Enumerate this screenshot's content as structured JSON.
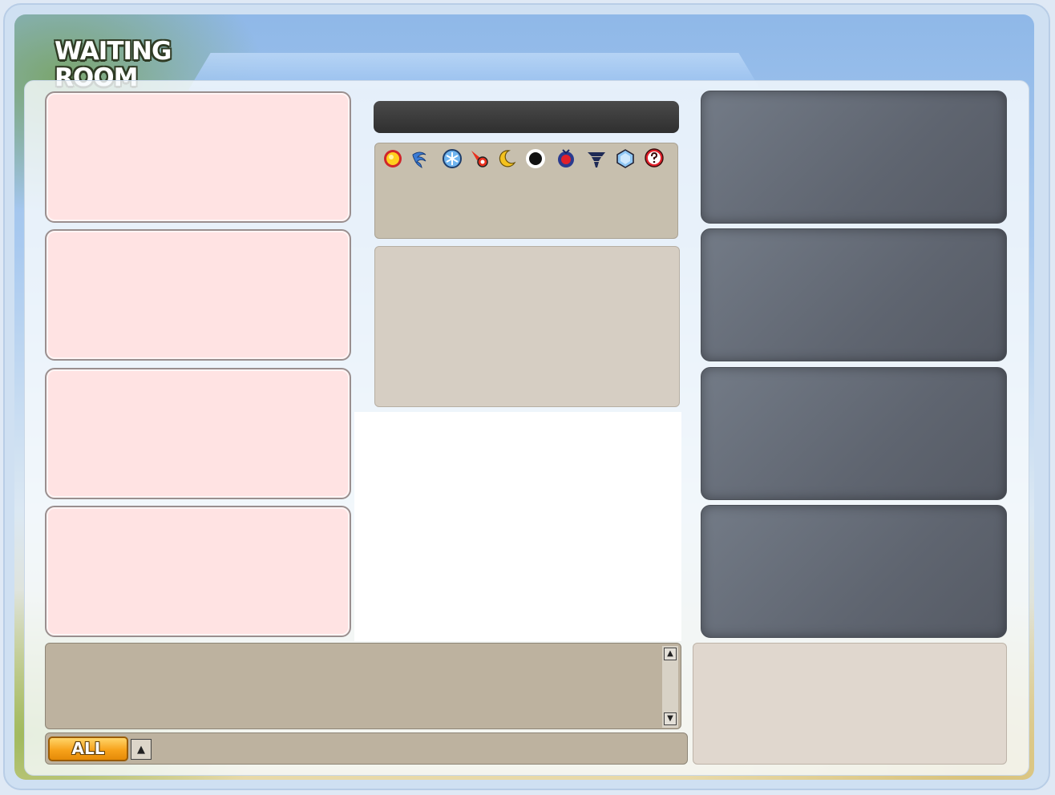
{
  "header": {
    "title": "WAITING\nROOM"
  },
  "colors": {
    "team_slot_red": "#ffe3e3",
    "team_slot_dark": "#5f6570",
    "chat_button": "#f7a21b"
  },
  "players": {
    "left_slots": [
      "",
      "",
      "",
      ""
    ],
    "right_slots": [
      "",
      "",
      "",
      ""
    ]
  },
  "map": {
    "name": ""
  },
  "items": [
    {
      "icon": "sun-orb-icon"
    },
    {
      "icon": "whirlwind-icon"
    },
    {
      "icon": "ice-shield-icon"
    },
    {
      "icon": "fireball-icon"
    },
    {
      "icon": "crescent-moon-icon"
    },
    {
      "icon": "black-bomb-icon"
    },
    {
      "icon": "red-bomb-icon"
    },
    {
      "icon": "tornado-icon"
    },
    {
      "icon": "crystal-shield-icon"
    },
    {
      "icon": "random-item-icon"
    }
  ],
  "chat": {
    "mode_label": "ALL",
    "scroll_up": "▲",
    "scroll_down": "▼",
    "mode_toggle": "▲"
  }
}
